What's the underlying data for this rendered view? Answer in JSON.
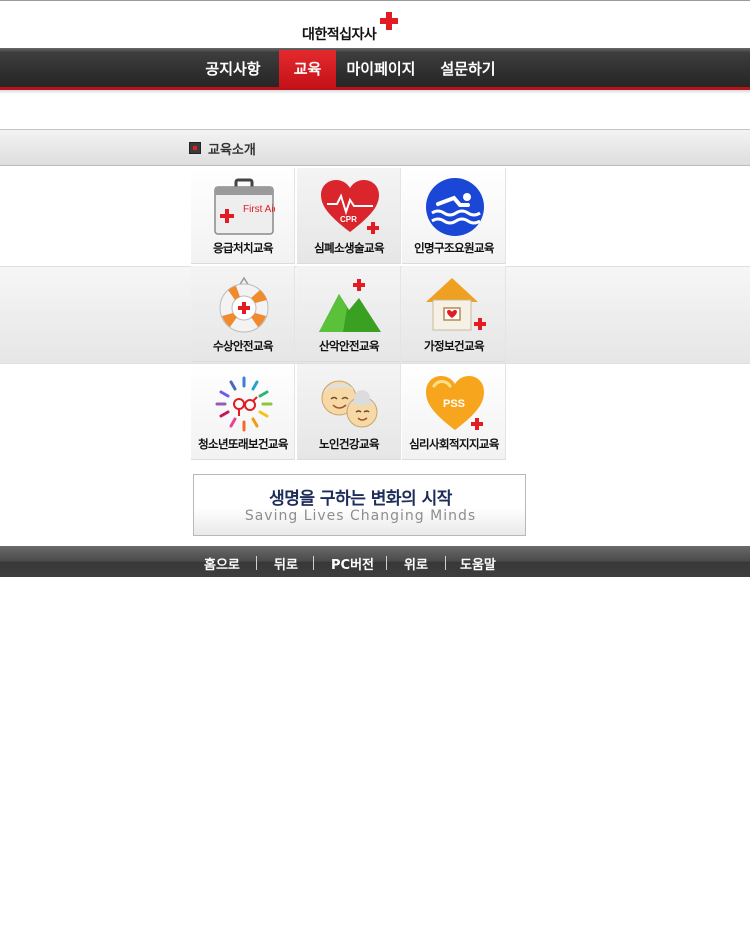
{
  "header": {
    "logo_text": "대한적십자사",
    "accent_color": "#e31b23"
  },
  "nav": {
    "items": [
      {
        "label": "공지사항",
        "active": false
      },
      {
        "label": "교육",
        "active": true
      },
      {
        "label": "마이페이지",
        "active": false
      },
      {
        "label": "설문하기",
        "active": false
      }
    ]
  },
  "section": {
    "title": "교육소개"
  },
  "education": {
    "items": [
      {
        "label": "응급처치교육",
        "icon": "first-aid-kit-icon"
      },
      {
        "label": "심폐소생술교육",
        "icon": "cpr-heart-icon"
      },
      {
        "label": "인명구조요원교육",
        "icon": "swimmer-icon"
      },
      {
        "label": "수상안전교육",
        "icon": "life-ring-icon"
      },
      {
        "label": "산악안전교육",
        "icon": "mountain-icon"
      },
      {
        "label": "가정보건교육",
        "icon": "house-icon"
      },
      {
        "label": "청소년또래보건교육",
        "icon": "youth-circle-icon"
      },
      {
        "label": "노인건강교육",
        "icon": "elderly-couple-icon"
      },
      {
        "label": "심리사회적지지교육",
        "icon": "pss-heart-icon"
      }
    ],
    "icon_texts": {
      "first_aid": "First Aid",
      "cpr": "CPR",
      "pss": "PSS"
    }
  },
  "banner": {
    "main": "생명을 구하는 변화의 시작",
    "sub": "Saving Lives Changing Minds"
  },
  "footer": {
    "items": [
      "홈으로",
      "뒤로",
      "PC버전",
      "위로",
      "도움말"
    ]
  }
}
